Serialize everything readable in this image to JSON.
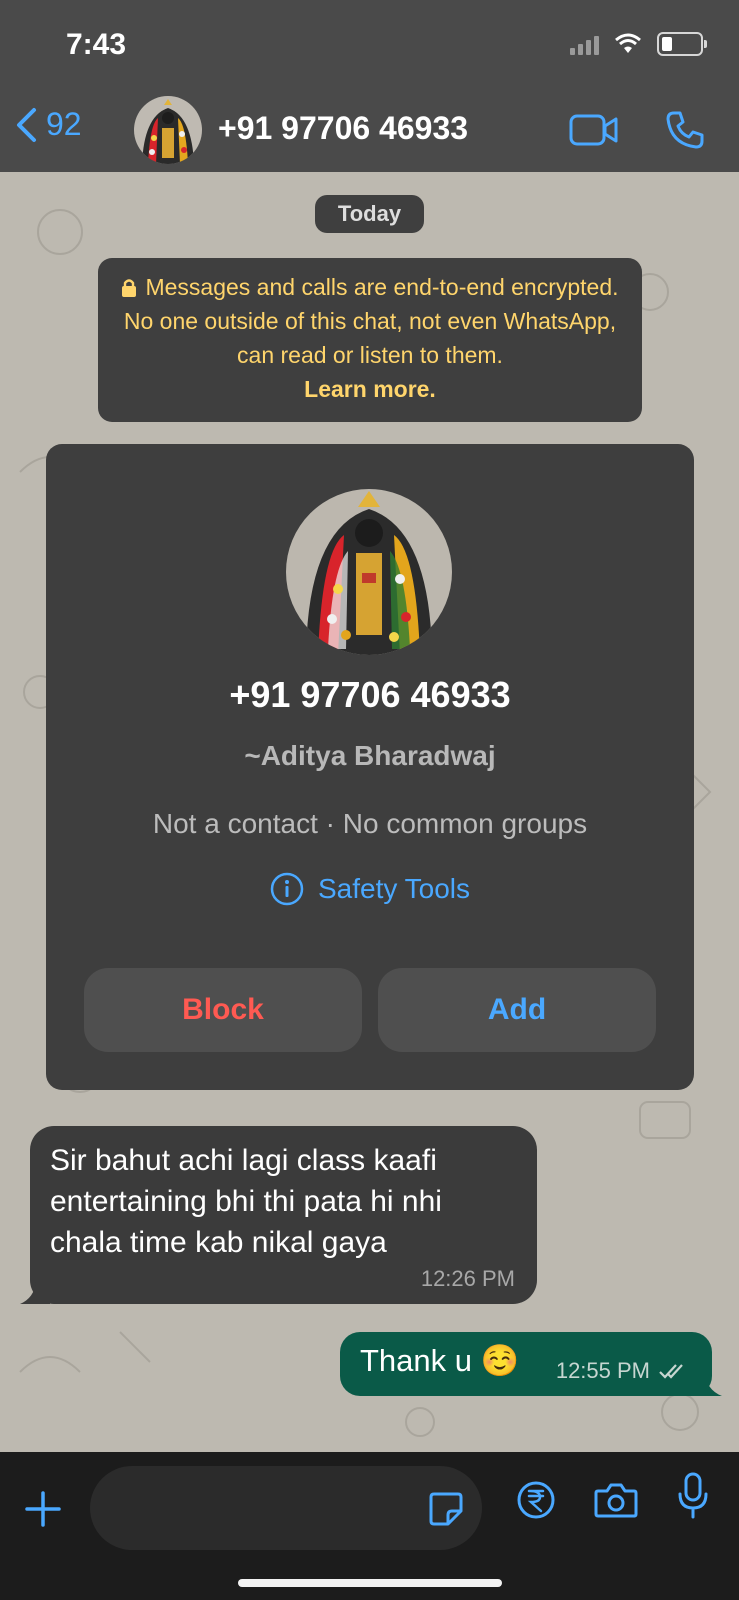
{
  "status": {
    "time": "7:43"
  },
  "header": {
    "back_count": "92",
    "title": "+91 97706 46933"
  },
  "chat": {
    "date_label": "Today",
    "encryption": {
      "message": "Messages and calls are end-to-end encrypted. No one outside of this chat, not even WhatsApp, can read or listen to them.",
      "link": "Learn more."
    },
    "contact_card": {
      "phone": "+91 97706 46933",
      "name": "~Aditya Bharadwaj",
      "meta": "Not a contact · No common groups",
      "safety": "Safety Tools",
      "block_label": "Block",
      "add_label": "Add"
    },
    "messages": [
      {
        "direction": "incoming",
        "text": "Sir bahut achi lagi class kaafi entertaining bhi thi pata hi nhi chala time kab nikal gaya",
        "time": "12:26 PM"
      },
      {
        "direction": "outgoing",
        "text": "Thank u ☺️",
        "time": "12:55 PM"
      }
    ]
  },
  "composer": {
    "placeholder": ""
  },
  "colors": {
    "accent": "#4aa8ff",
    "header_bg": "#4a4a4a",
    "chat_bg": "#bdb9b0",
    "incoming_bubble": "#3b3b3b",
    "outgoing_bubble": "#0a5a48",
    "block_red": "#ff5a52",
    "encryption_text": "#ffd56c"
  },
  "icons": [
    "back-chevron-icon",
    "video-call-icon",
    "phone-icon",
    "lock-icon",
    "info-icon",
    "plus-icon",
    "sticker-icon",
    "rupee-icon",
    "camera-icon",
    "mic-icon",
    "double-check-icon"
  ]
}
